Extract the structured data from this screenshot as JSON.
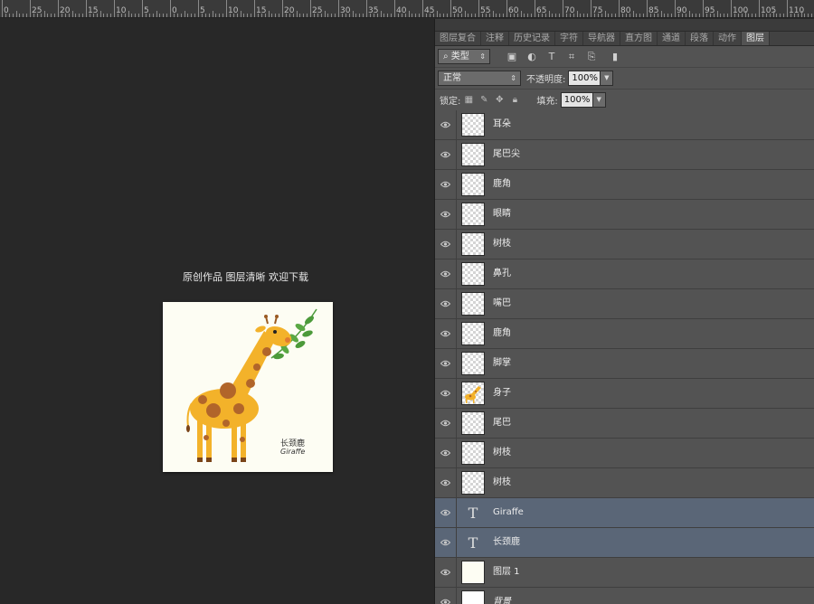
{
  "ruler": {
    "labels": [
      "0",
      "25",
      "20",
      "15",
      "10",
      "5",
      "0",
      "5",
      "10",
      "15",
      "20",
      "25",
      "30",
      "35",
      "40",
      "45",
      "50",
      "55",
      "60",
      "65",
      "70",
      "75",
      "80",
      "85",
      "90",
      "95",
      "100",
      "105",
      "110"
    ]
  },
  "canvas": {
    "title": "原创作品 图层清晰 欢迎下载",
    "artwork_text_cn": "长颈鹿",
    "artwork_text_en": "Giraffe"
  },
  "panel": {
    "tabs": [
      "图层复合",
      "注释",
      "历史记录",
      "字符",
      "导航器",
      "直方图",
      "通道",
      "段落",
      "动作",
      "图层"
    ],
    "active_tab": "图层",
    "filter": {
      "kind_label": "类型"
    },
    "blend_mode": "正常",
    "opacity_label": "不透明度:",
    "opacity_value": "100%",
    "lock_label": "锁定:",
    "fill_label": "填充:",
    "fill_value": "100%"
  },
  "layers": [
    {
      "name": "耳朵",
      "thumb": "transparent",
      "selected": false
    },
    {
      "name": "尾巴尖",
      "thumb": "transparent",
      "selected": false
    },
    {
      "name": "鹿角",
      "thumb": "transparent",
      "selected": false
    },
    {
      "name": "眼睛",
      "thumb": "transparent",
      "selected": false
    },
    {
      "name": "树枝",
      "thumb": "transparent",
      "selected": false
    },
    {
      "name": "鼻孔",
      "thumb": "transparent",
      "selected": false
    },
    {
      "name": "嘴巴",
      "thumb": "transparent",
      "selected": false
    },
    {
      "name": "鹿角",
      "thumb": "transparent",
      "selected": false
    },
    {
      "name": "脚掌",
      "thumb": "transparent",
      "selected": false
    },
    {
      "name": "身子",
      "thumb": "giraffe",
      "selected": false
    },
    {
      "name": "尾巴",
      "thumb": "transparent",
      "selected": false
    },
    {
      "name": "树枝",
      "thumb": "transparent",
      "selected": false
    },
    {
      "name": "树枝",
      "thumb": "transparent",
      "selected": false
    },
    {
      "name": "Giraffe",
      "thumb": "text",
      "selected": true
    },
    {
      "name": "长颈鹿",
      "thumb": "text",
      "selected": true
    },
    {
      "name": "图层 1",
      "thumb": "plain",
      "selected": false
    },
    {
      "name": "背景",
      "thumb": "white",
      "selected": false
    }
  ],
  "colors": {
    "accent_selected": "#5a6677",
    "giraffe_body": "#f3b22a",
    "giraffe_spots": "#b1652a",
    "leaves": "#4c9a3a"
  }
}
